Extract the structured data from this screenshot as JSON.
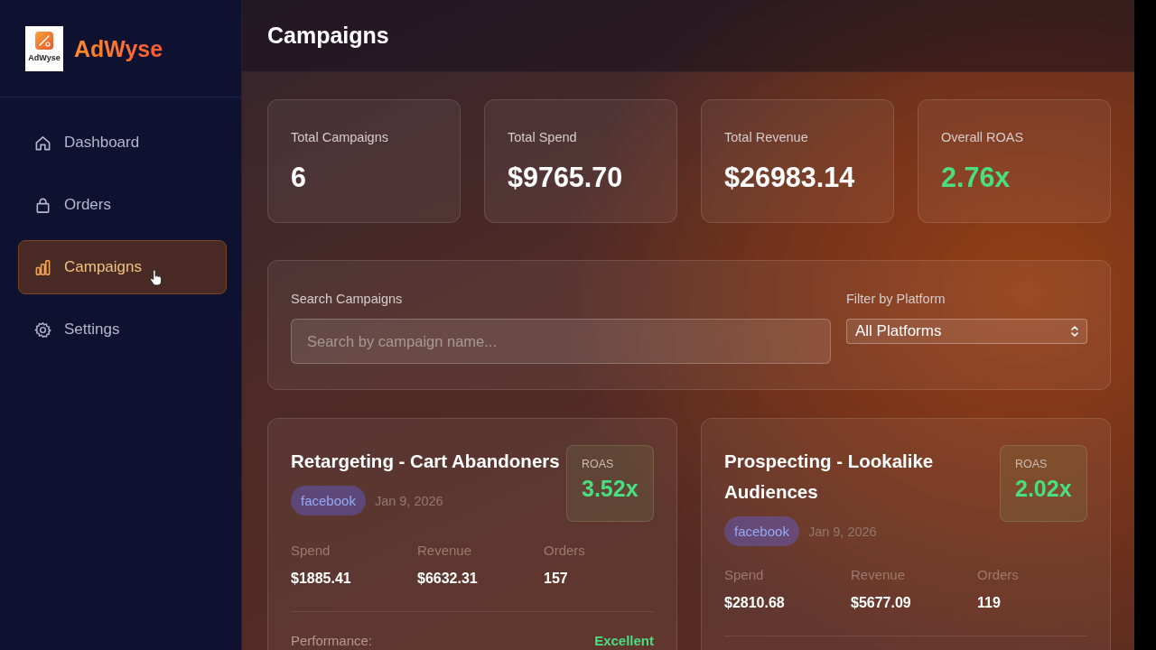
{
  "sidebar": {
    "logo_caption": "AdWyse",
    "brand": "AdWyse",
    "nav": [
      {
        "label": "Dashboard",
        "selected": false
      },
      {
        "label": "Orders",
        "selected": false
      },
      {
        "label": "Campaigns",
        "selected": true
      },
      {
        "label": "Settings",
        "selected": false
      }
    ]
  },
  "header": {
    "title": "Campaigns"
  },
  "stats": [
    {
      "label": "Total Campaigns",
      "value": "6",
      "accent": false
    },
    {
      "label": "Total Spend",
      "value": "$9765.70",
      "accent": false
    },
    {
      "label": "Total Revenue",
      "value": "$26983.14",
      "accent": false
    },
    {
      "label": "Overall ROAS",
      "value": "2.76x",
      "accent": true
    }
  ],
  "filters": {
    "search": {
      "label": "Search Campaigns",
      "placeholder": "Search by campaign name..."
    },
    "platform": {
      "label": "Filter by Platform",
      "value": "All Platforms"
    }
  },
  "campaigns": [
    {
      "name": "Retargeting - Cart Abandoners",
      "platform": "facebook",
      "date": "Jan 9, 2026",
      "roas_label": "ROAS",
      "roas": "3.52x",
      "metrics": [
        {
          "label": "Spend",
          "value": "$1885.41"
        },
        {
          "label": "Revenue",
          "value": "$6632.31"
        },
        {
          "label": "Orders",
          "value": "157"
        }
      ],
      "performance": {
        "label": "Performance:",
        "value": "Excellent"
      }
    },
    {
      "name": "Prospecting - Lookalike Audiences",
      "platform": "facebook",
      "date": "Jan 9, 2026",
      "roas_label": "ROAS",
      "roas": "2.02x",
      "metrics": [
        {
          "label": "Spend",
          "value": "$2810.68"
        },
        {
          "label": "Revenue",
          "value": "$5677.09"
        },
        {
          "label": "Orders",
          "value": "119"
        }
      ]
    }
  ]
}
